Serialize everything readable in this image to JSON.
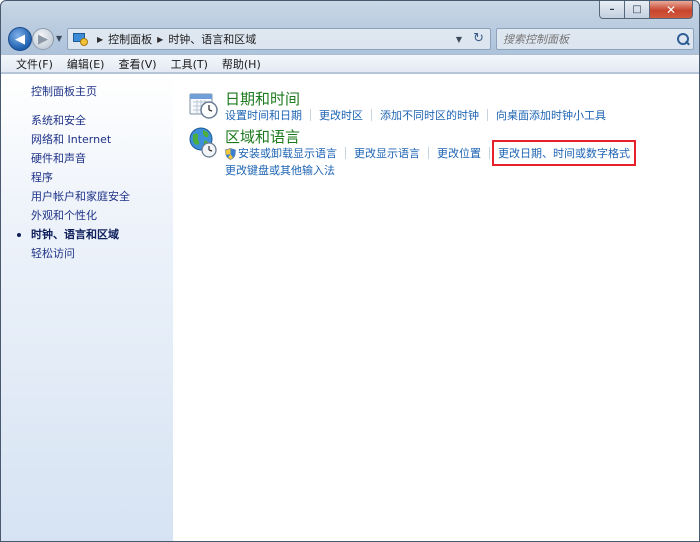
{
  "window": {
    "caption": {
      "minimize": "–",
      "maximize": "□",
      "close": "✕"
    }
  },
  "address_bar": {
    "breadcrumbs": [
      "控制面板",
      "时钟、语言和区域"
    ],
    "search_placeholder": "搜索控制面板"
  },
  "menu": {
    "items": [
      "文件(F)",
      "编辑(E)",
      "查看(V)",
      "工具(T)",
      "帮助(H)"
    ]
  },
  "sidebar": {
    "home": "控制面板主页",
    "items": [
      {
        "label": "系统和安全"
      },
      {
        "label": "网络和 Internet"
      },
      {
        "label": "硬件和声音"
      },
      {
        "label": "程序"
      },
      {
        "label": "用户帐户和家庭安全"
      },
      {
        "label": "外观和个性化"
      },
      {
        "label": "时钟、语言和区域",
        "active": true
      },
      {
        "label": "轻松访问"
      }
    ]
  },
  "categories": [
    {
      "title": "日期和时间",
      "icon": "calendar-clock-icon",
      "links": [
        "设置时间和日期",
        "更改时区",
        "添加不同时区的时钟",
        "向桌面添加时钟小工具"
      ]
    },
    {
      "title": "区域和语言",
      "icon": "globe-clock-icon",
      "links": [
        "安装或卸载显示语言",
        "更改显示语言",
        "更改位置",
        "更改日期、时间或数字格式"
      ],
      "links_row2": [
        "更改键盘或其他输入法"
      ],
      "highlighted_link": "更改日期、时间或数字格式"
    }
  ],
  "colors": {
    "category_title": "#1e7a1e",
    "link": "#1e64b4",
    "sidebar_link": "#1e3287",
    "highlight_box": "#e8202a"
  }
}
